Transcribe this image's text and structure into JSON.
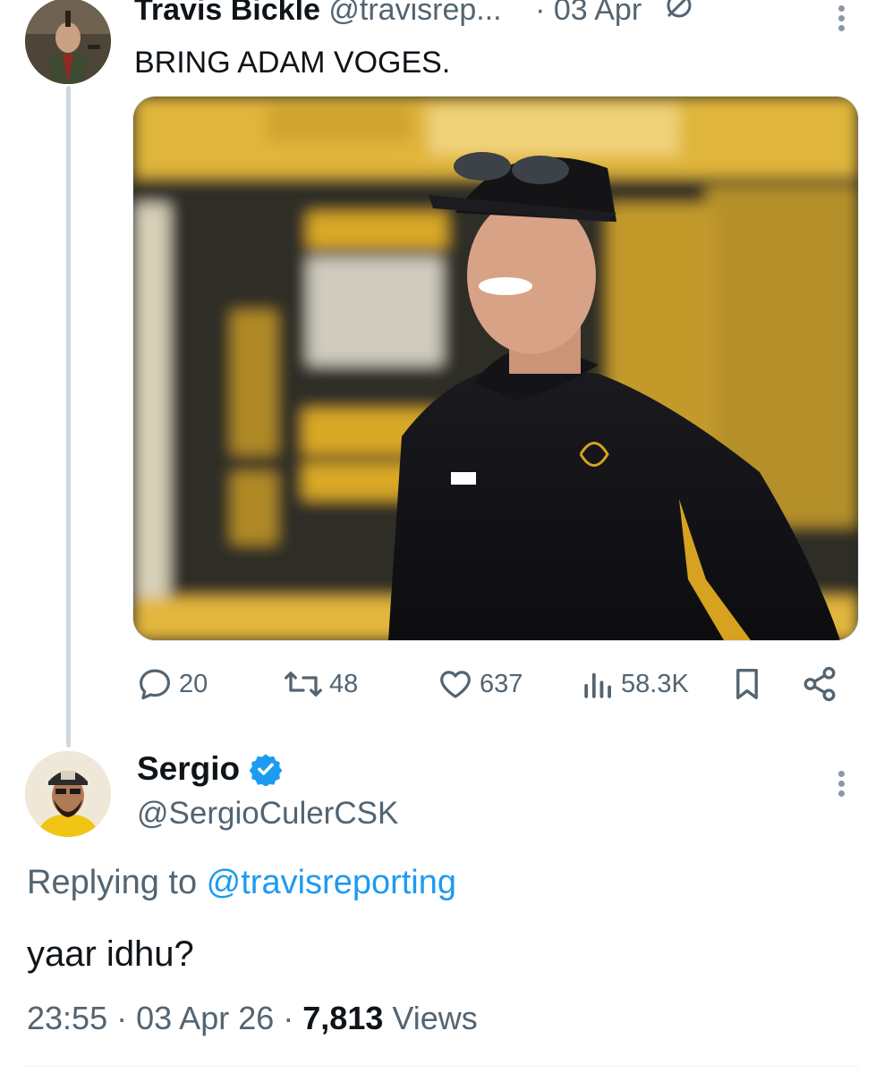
{
  "tweet1": {
    "name": "Travis Bickle",
    "handle": "@travisrep...",
    "separator": "·",
    "date": "03 Apr",
    "text": "BRING ADAM VOGES.",
    "actions": {
      "replies": "20",
      "reposts": "48",
      "likes": "637",
      "views": "58.3K"
    }
  },
  "tweet2": {
    "name": "Sergio",
    "handle": "@SergioCulerCSK",
    "replying_prefix": "Replying to ",
    "replying_handle": "@travisreporting",
    "text": "yaar idhu?",
    "time": "23:55",
    "sep1": "·",
    "date": "03 Apr 26",
    "sep2": "·",
    "views_count": "7,813",
    "views_label": " Views"
  },
  "colors": {
    "text": "#0f1419",
    "secondary": "#536471",
    "link": "#1d9bf0",
    "verified": "#1d9bf0",
    "thread_line": "#cfd9de"
  },
  "icons": [
    "reply-icon",
    "repost-icon",
    "like-icon",
    "views-icon",
    "bookmark-icon",
    "share-icon",
    "verified-badge-icon",
    "more-icon",
    "grok-icon"
  ]
}
